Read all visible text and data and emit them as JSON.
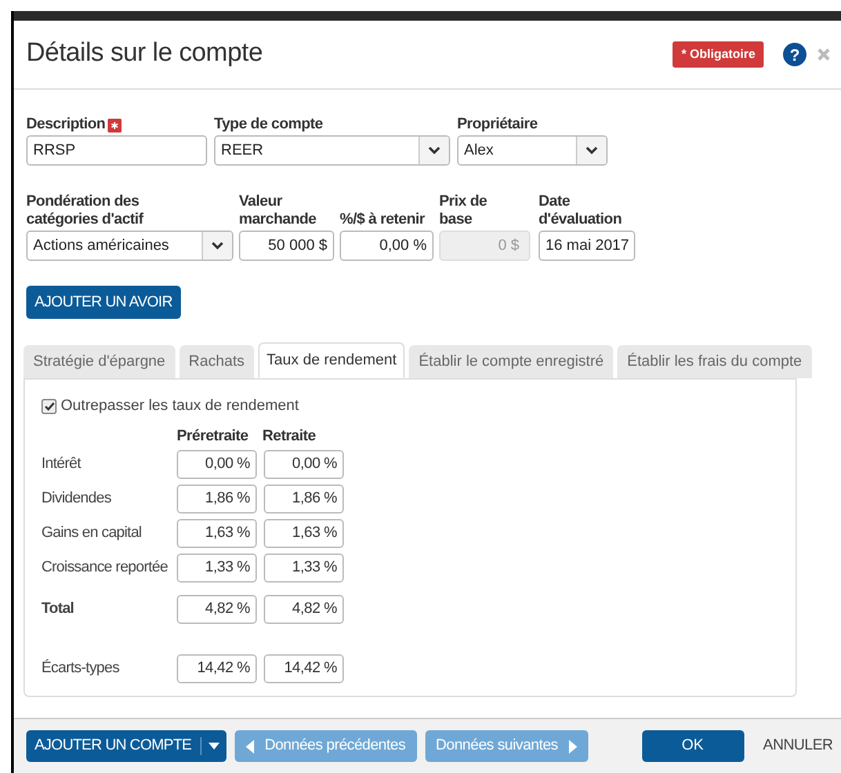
{
  "dialog": {
    "title": "Détails sur le compte",
    "required_badge": "* Obligatoire",
    "help": "?"
  },
  "fields_row1": [
    {
      "label": "Description",
      "required": true,
      "kind": "text",
      "value": "RRSP"
    },
    {
      "label": "Type de compte",
      "required": false,
      "kind": "select",
      "value": "REER"
    },
    {
      "label": "Propriétaire",
      "required": false,
      "kind": "select",
      "value": "Alex"
    }
  ],
  "fields_row2": [
    {
      "label": "Pondération des catégories d'actif",
      "kind": "select",
      "value": "Actions américaines",
      "disabled": false
    },
    {
      "label": "Valeur marchande",
      "kind": "number",
      "value": "50 000 $",
      "disabled": false
    },
    {
      "label": "%/$ à retenir",
      "kind": "number",
      "value": "0,00 %",
      "disabled": false
    },
    {
      "label": "Prix de base",
      "kind": "number",
      "value": "0 $",
      "disabled": true
    },
    {
      "label": "Date d'évaluation",
      "kind": "text",
      "value": "16 mai 2017",
      "disabled": false
    }
  ],
  "add_holding_button": "AJOUTER UN AVOIR",
  "tabs": [
    {
      "label": "Stratégie d'épargne",
      "selected": false
    },
    {
      "label": "Rachats",
      "selected": false
    },
    {
      "label": "Taux de rendement",
      "selected": true
    },
    {
      "label": "Établir le compte enregistré",
      "selected": false
    },
    {
      "label": "Établir les frais du compte",
      "selected": false
    }
  ],
  "override_rates": {
    "label": "Outrepasser les taux de rendement",
    "checked": true
  },
  "rates": {
    "columns": [
      "Préretraite",
      "Retraite"
    ],
    "rows": [
      {
        "label": "Intérêt",
        "kind": "rate",
        "values": [
          "0,00 %",
          "0,00 %"
        ]
      },
      {
        "label": "Dividendes",
        "kind": "rate",
        "values": [
          "1,86 %",
          "1,86 %"
        ]
      },
      {
        "label": "Gains en capital",
        "kind": "rate",
        "values": [
          "1,63 %",
          "1,63 %"
        ]
      },
      {
        "label": "Croissance reportée",
        "kind": "rate",
        "values": [
          "1,33 %",
          "1,33 %"
        ]
      },
      {
        "label": "Total",
        "kind": "total",
        "values": [
          "4,82 %",
          "4,82 %"
        ]
      },
      {
        "label": "Écarts-types",
        "kind": "deviation",
        "values": [
          "14,42 %",
          "14,42 %"
        ]
      }
    ]
  },
  "footer": {
    "add_account": "AJOUTER UN COMPTE",
    "previous": "Données précédentes",
    "next": "Données suivantes",
    "ok": "OK",
    "cancel": "ANNULER"
  }
}
